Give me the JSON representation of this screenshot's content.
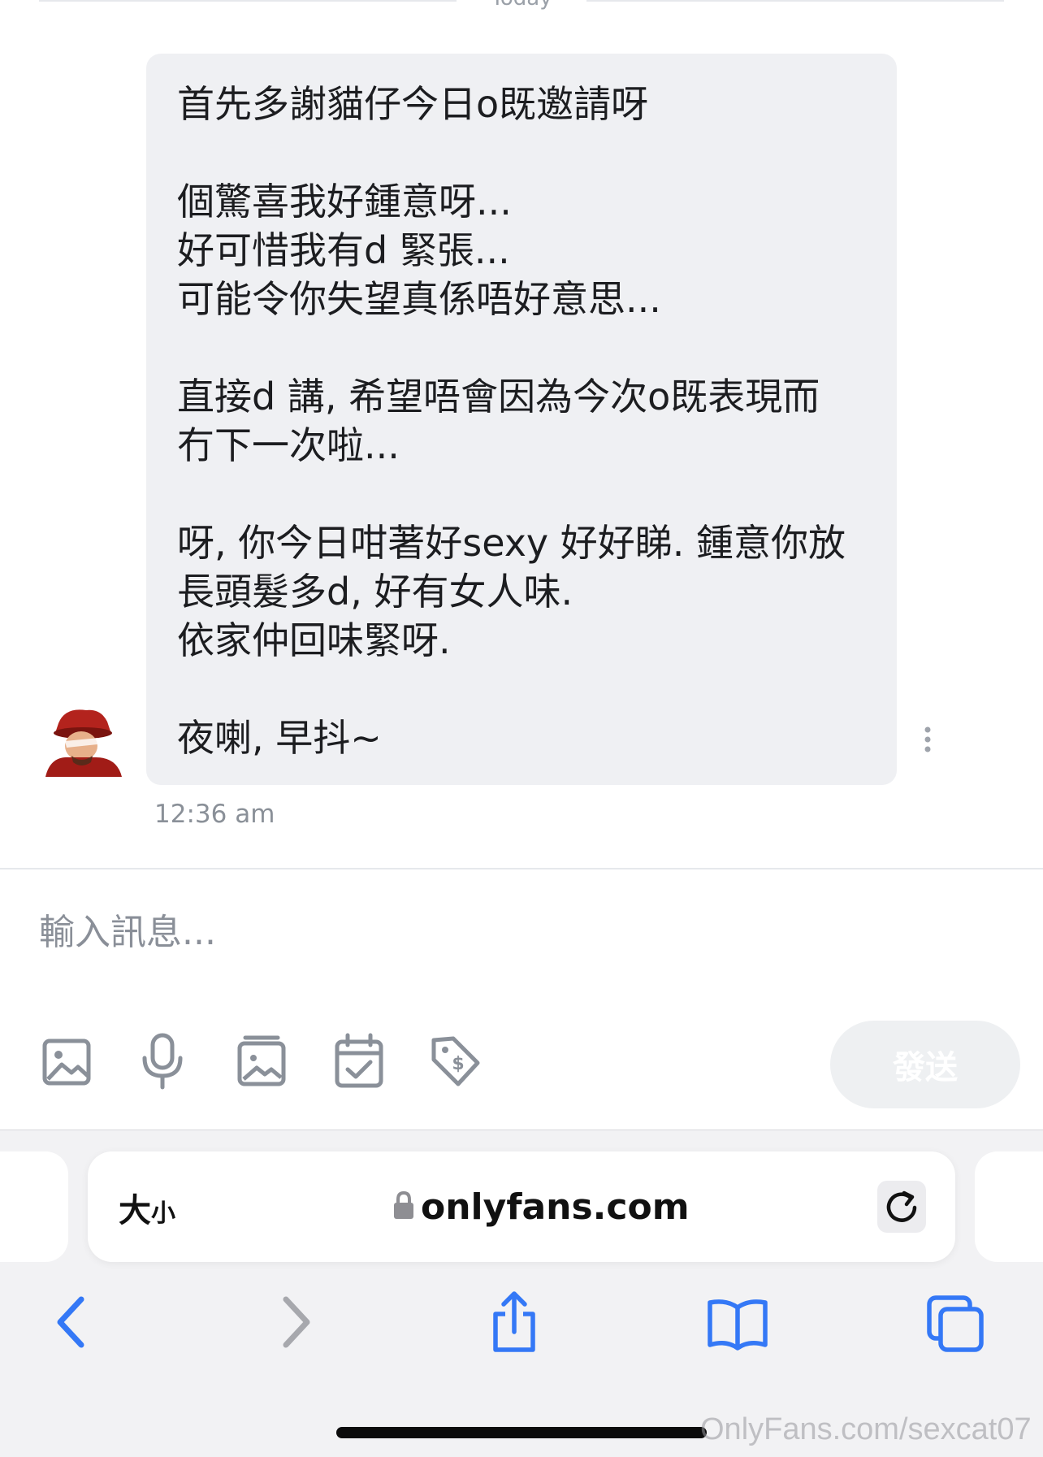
{
  "day_divider": "Today",
  "message": {
    "lines": [
      "首先多謝貓仔今日o既邀請呀",
      "",
      "個驚喜我好鍾意呀...",
      "好可惜我有d 緊張...",
      "可能令你失望真係唔好意思...",
      "",
      "直接d 講, 希望唔會因為今次o既表現而",
      "冇下一次啦...",
      "",
      "呀, 你今日咁著好sexy 好好睇. 鍾意你放",
      "長頭髮多d, 好有女人味.",
      "依家仲回味緊呀.",
      "",
      "夜喇, 早抖~"
    ],
    "timestamp": "12:36 am"
  },
  "composer": {
    "placeholder": "輸入訊息...",
    "send_label": "發送",
    "tools": [
      "image-icon",
      "microphone-icon",
      "media-vault-icon",
      "calendar-check-icon",
      "price-tag-icon"
    ]
  },
  "browser": {
    "text_size_big": "大",
    "text_size_small": "小",
    "url": "onlyfans.com"
  },
  "watermark": "OnlyFans.com/sexcat07",
  "colors": {
    "accent": "#3478f6",
    "bubble": "#eff0f3",
    "send_disabled": "#eef0f2"
  }
}
